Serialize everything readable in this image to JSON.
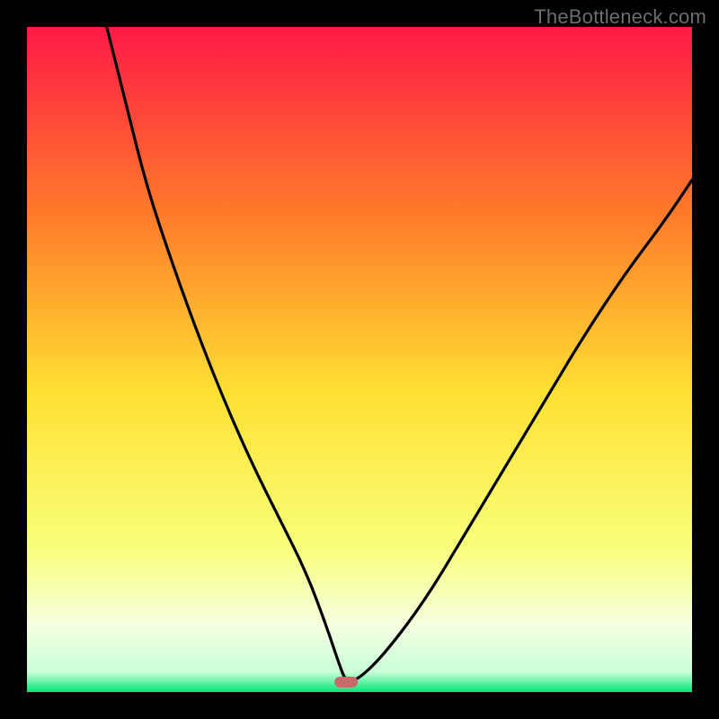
{
  "watermark": "TheBottleneck.com",
  "chart_data": {
    "type": "line",
    "title": "",
    "xlabel": "",
    "ylabel": "",
    "xlim": [
      0,
      100
    ],
    "ylim": [
      0,
      100
    ],
    "gradient_colors": {
      "top": "#ff1a47",
      "upper_mid": "#ff7a2a",
      "mid": "#ffe033",
      "lower_mid": "#f9ff7a",
      "pale": "#f6ffe0",
      "bottom": "#00e676"
    },
    "marker": {
      "x": 48,
      "y": 1.5,
      "color": "#c96a6a"
    },
    "series": [
      {
        "name": "curve",
        "x": [
          12,
          15,
          18,
          22,
          26,
          30,
          34,
          38,
          42,
          45,
          47,
          48,
          50,
          54,
          60,
          66,
          72,
          78,
          84,
          90,
          96,
          100
        ],
        "y": [
          100,
          88,
          76,
          64,
          53,
          43,
          34,
          26,
          18,
          10,
          4,
          1.5,
          2,
          6,
          14,
          24,
          34,
          44,
          54,
          63,
          71,
          77
        ]
      }
    ]
  }
}
